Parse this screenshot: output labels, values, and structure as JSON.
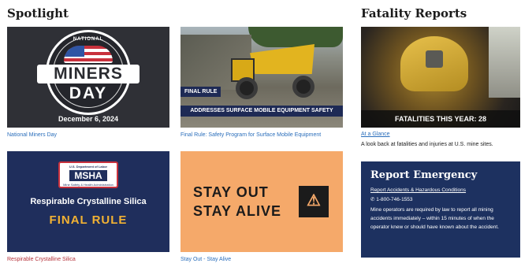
{
  "spotlight": {
    "heading": "Spotlight",
    "cards": [
      {
        "caption": "National Miners Day",
        "badge_top": "NATIONAL",
        "badge_word1": "MINERS",
        "badge_word2": "DAY",
        "date": "December 6, 2024"
      },
      {
        "caption": "Final Rule: Safety Program for Surface Mobile Equipment",
        "label": "FINAL RULE",
        "banner": "ADDRESSES SURFACE MOBILE EQUIPMENT SAFETY"
      },
      {
        "caption": "Respirable Crystalline Silica",
        "dept": "U.S. Department of Labor",
        "agency": "MSHA",
        "agency_sub": "Mine Safety & Health Administration",
        "title": "Respirable Crystalline Silica",
        "subtitle": "FINAL RULE"
      },
      {
        "caption": "Stay Out - Stay Alive",
        "line1": "STAY OUT",
        "line2": "STAY ALIVE"
      }
    ]
  },
  "fatality": {
    "heading": "Fatality Reports",
    "banner": "FATALITIES THIS YEAR: 28",
    "link": "At a Glance",
    "description": "A look back at fatalities and injuries at U.S. mine sites."
  },
  "report": {
    "title": "Report Emergency",
    "link": "Report Accidents & Hazardous Conditions",
    "phone": "1-800-746-1553",
    "body": "Mine operators are required by law to report all mining accidents immediately – within 15 minutes of when the operator knew or should have known about the accident."
  },
  "icons": {
    "phone": "phone-icon",
    "warning": "falling-person-warning-icon"
  }
}
